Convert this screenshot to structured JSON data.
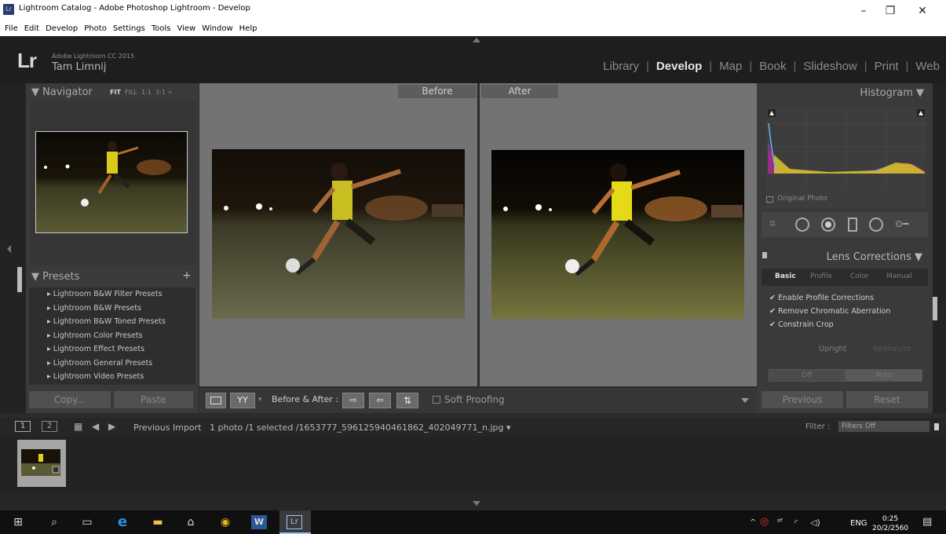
{
  "window": {
    "title": "Lightroom Catalog - Adobe Photoshop Lightroom - Develop",
    "app_icon": "Lr",
    "controls": [
      "–",
      "❐",
      "✕"
    ]
  },
  "menu": [
    "File",
    "Edit",
    "Develop",
    "Photo",
    "Settings",
    "Tools",
    "View",
    "Window",
    "Help"
  ],
  "identity": {
    "logo": "Lr",
    "version": "Adobe Lightroom CC 2015",
    "user": "Tam Limnij"
  },
  "modules": [
    "Library",
    "Develop",
    "Map",
    "Book",
    "Slideshow",
    "Print",
    "Web"
  ],
  "active_module": "Develop",
  "left_panel": {
    "navigator_title": "Navigator",
    "zoom_fit": "FIT",
    "zoom_fill": "FILL",
    "zoom_1": "1:1",
    "zoom_3": "3:1 ÷",
    "presets_title": "Presets",
    "presets": [
      "Lightroom B&W Filter Presets",
      "Lightroom B&W Presets",
      "Lightroom B&W Toned Presets",
      "Lightroom Color Presets",
      "Lightroom Effect Presets",
      "Lightroom General Presets",
      "Lightroom Video Presets"
    ],
    "copy_label": "Copy...",
    "paste_label": "Paste"
  },
  "center": {
    "before_label": "Before",
    "after_label": "After",
    "toolbar_before_after": "Before & After :",
    "soft_proofing": "Soft Proofing"
  },
  "right_panel": {
    "histogram_title": "Histogram",
    "original_photo": "Original Photo",
    "lens_title": "Lens Corrections",
    "lens_tabs": [
      "Basic",
      "Profile",
      "Color",
      "Manual"
    ],
    "checks": [
      "Enable Profile Corrections",
      "Remove Chromatic Aberration",
      "Constrain Crop"
    ],
    "upright_label": "Upright",
    "reanalyze_label": "Reanalyze",
    "off_label": "Off",
    "auto_label": "Auto",
    "previous_label": "Previous",
    "reset_label": "Reset"
  },
  "filmbar": {
    "page1": "1",
    "page2": "2",
    "source": "Previous Import",
    "info": "1 photo /1 selected /1653777_596125940461862_402049771_n.jpg",
    "filter_label": "Filter :",
    "filter_value": "Filters Off"
  },
  "taskbar": {
    "lang": "ENG",
    "time": "0:25",
    "date": "20/2/2560",
    "lr_label": "Lr"
  }
}
